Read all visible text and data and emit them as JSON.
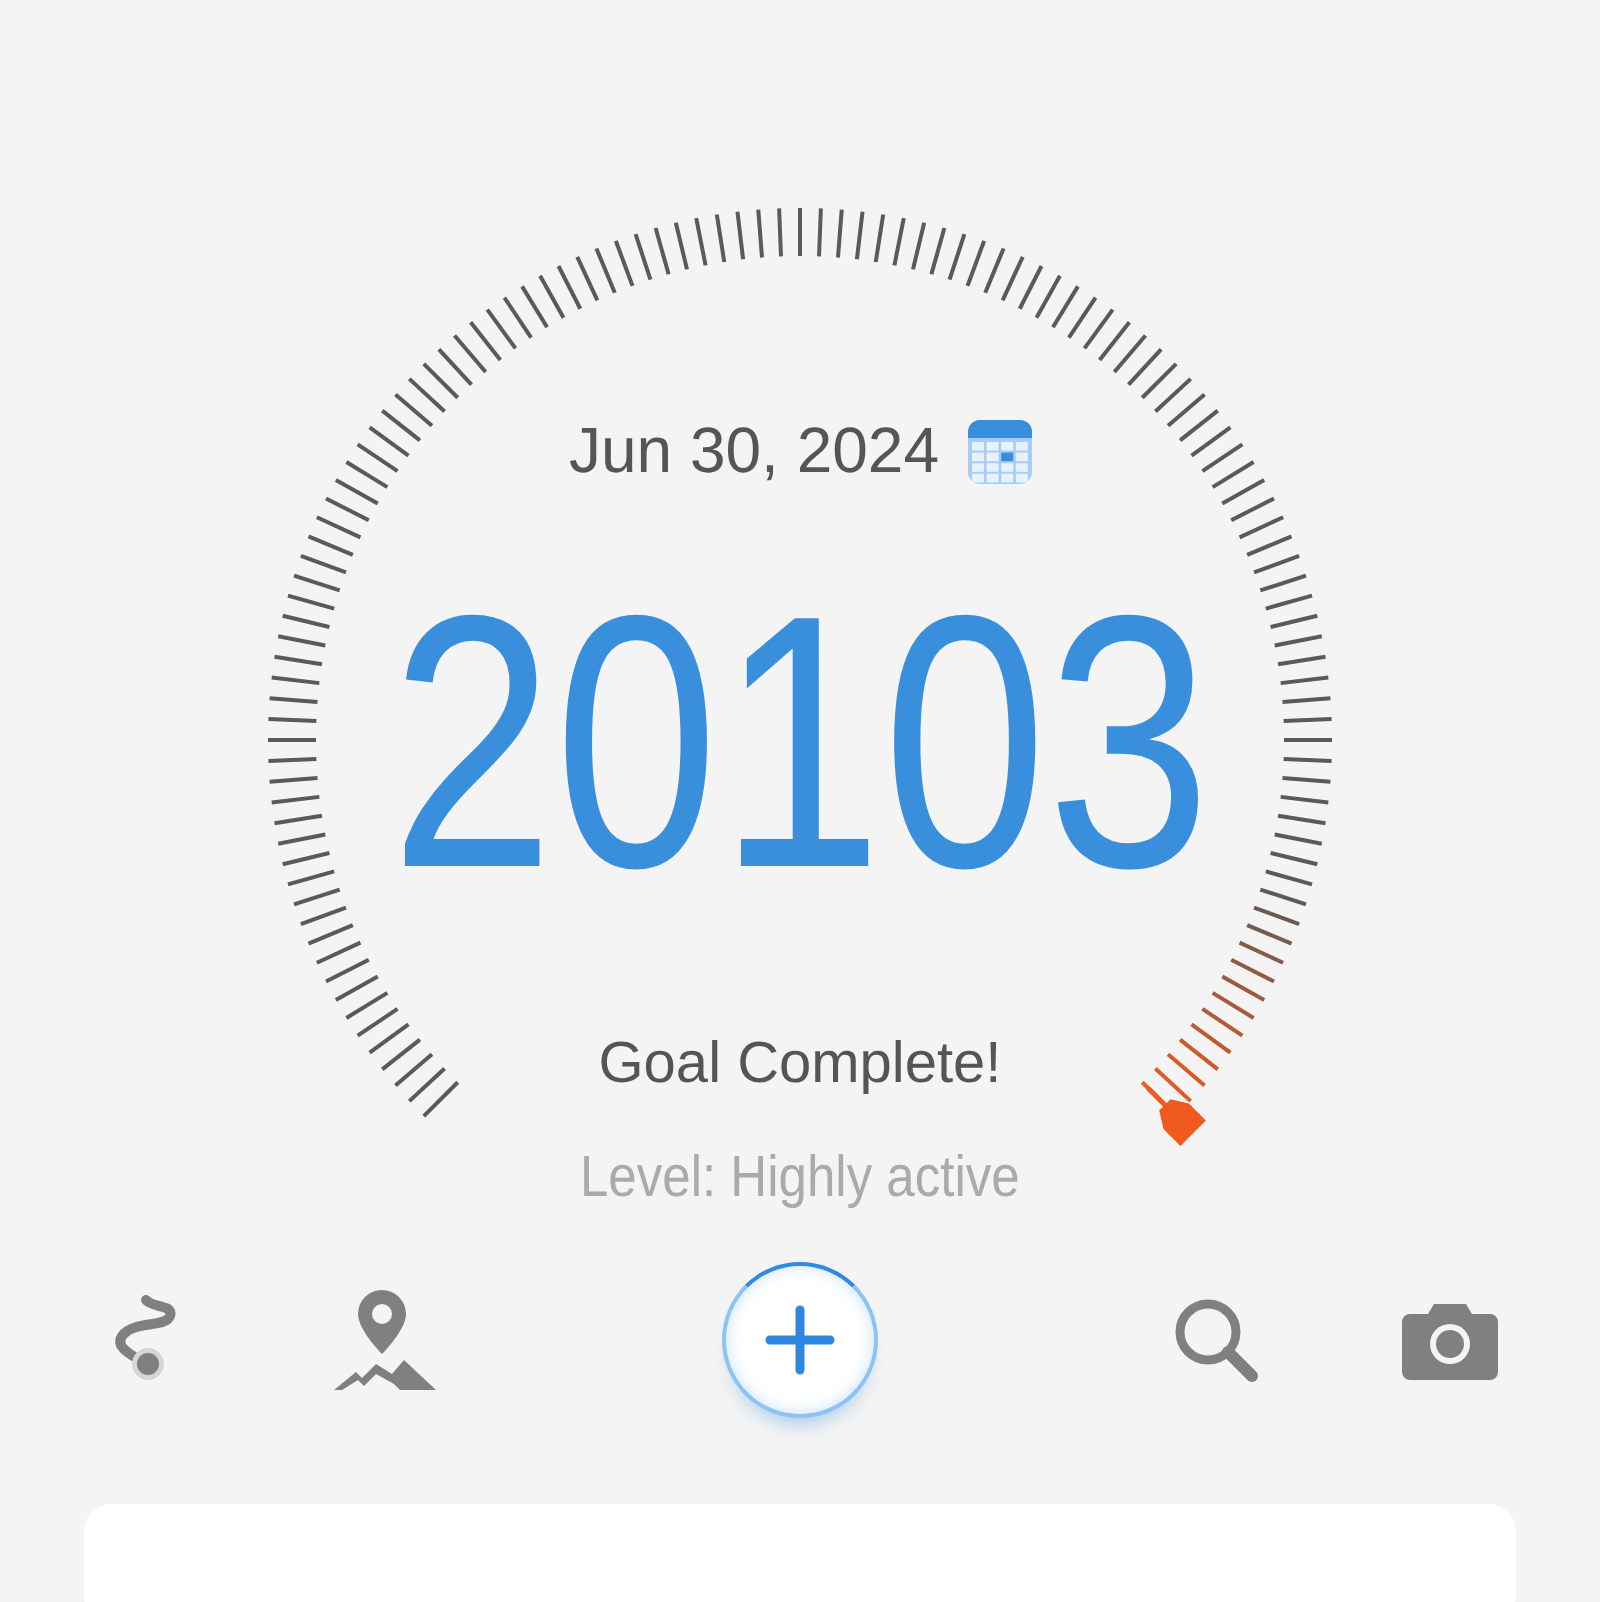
{
  "date": "Jun 30, 2024",
  "steps": "20103",
  "goal_message": "Goal Complete!",
  "activity_level": "Level: Highly active",
  "toolbar": [
    {
      "kind": "route"
    },
    {
      "kind": "map"
    },
    {
      "kind": "add"
    },
    {
      "kind": "search"
    },
    {
      "kind": "camera"
    }
  ]
}
